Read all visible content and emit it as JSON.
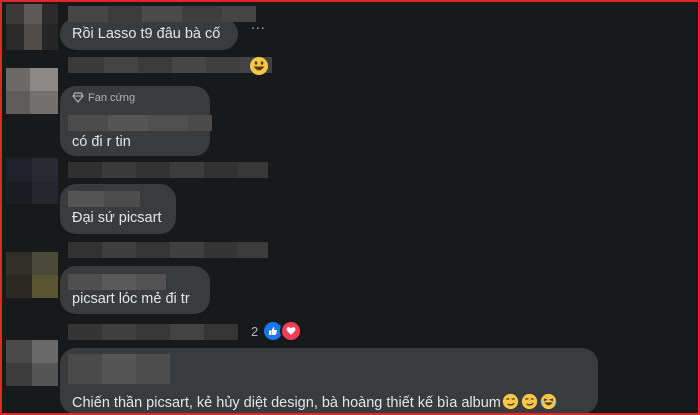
{
  "comments": [
    {
      "text": "Rồi Lasso t9 đâu bà cố",
      "more_label": "..."
    },
    {
      "badge": "Fan cứng",
      "text": "có đi r tin"
    },
    {
      "text": "Đại sứ picsart"
    },
    {
      "text": "picsart lóc mẻ đi tr",
      "reaction_count": "2",
      "reaction_icons": [
        "like-icon",
        "love-icon"
      ]
    },
    {
      "text": "Chiến thần picsart, kẻ hủy diệt design, bà hoàng thiết kế bìa album",
      "emojis": [
        "smirk-emoji",
        "smirk-emoji",
        "laughing-emoji"
      ]
    }
  ],
  "reaction_emoji": "grinning-emoji",
  "colors": {
    "frame_border": "#e4262b",
    "background": "#18191a",
    "bubble": "#3a3b3c",
    "text": "#e4e6eb",
    "muted": "#b0b3b8",
    "like": "#1877f2",
    "love": "#f33e58"
  }
}
